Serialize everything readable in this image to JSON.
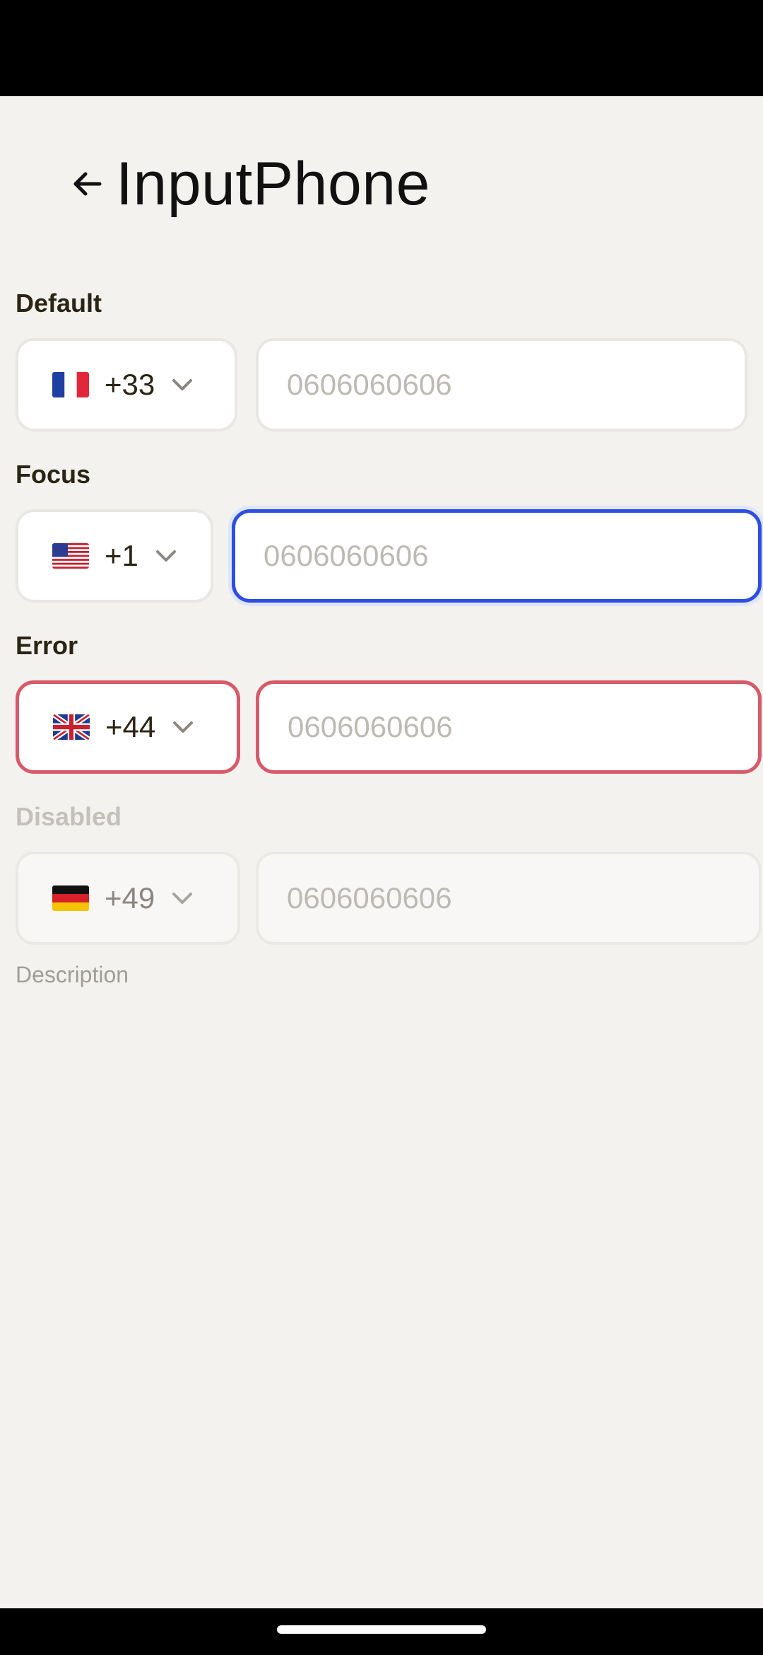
{
  "header": {
    "title": "InputPhone"
  },
  "sections": [
    {
      "label": "Default",
      "country_code": "+33",
      "flag": "france-flag-icon",
      "placeholder": "0606060606",
      "state": "default"
    },
    {
      "label": "Focus",
      "country_code": "+1",
      "flag": "usa-flag-icon",
      "placeholder": "0606060606",
      "state": "focus"
    },
    {
      "label": "Error",
      "country_code": "+44",
      "flag": "uk-flag-icon",
      "placeholder": "0606060606",
      "state": "error"
    },
    {
      "label": "Disabled",
      "country_code": "+49",
      "flag": "germany-flag-icon",
      "placeholder": "0606060606",
      "state": "disabled"
    }
  ],
  "description": "Description",
  "colors": {
    "focus": "#2d4ee0",
    "error": "#d65a6a",
    "background": "#f3f2ef"
  }
}
